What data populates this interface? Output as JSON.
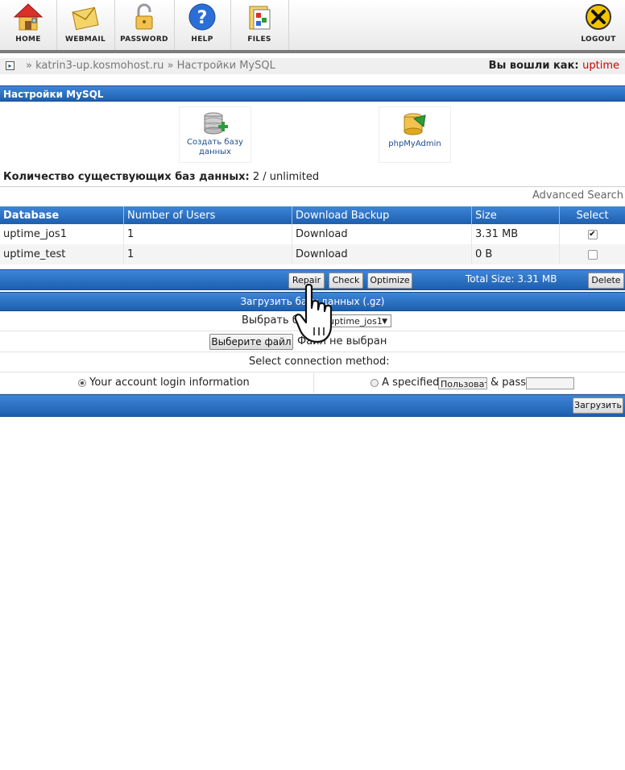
{
  "toolbar": {
    "items": [
      {
        "label": "HOME",
        "icon": "home-icon"
      },
      {
        "label": "WEBMAIL",
        "icon": "webmail-icon"
      },
      {
        "label": "PASSWORD",
        "icon": "lock-icon"
      },
      {
        "label": "HELP",
        "icon": "help-icon"
      },
      {
        "label": "FILES",
        "icon": "files-icon"
      }
    ],
    "logout": "LOGOUT"
  },
  "breadcrumb": {
    "host": "» katrin3-up.kosmohost.ru",
    "page": "» Настройки MySQL"
  },
  "login": {
    "label": "Вы вошли как:",
    "user": "uptime"
  },
  "section_title": "Настройки MySQL",
  "shortcuts": {
    "create_db": "Создать базу данных",
    "phpmyadmin": "phpMyAdmin"
  },
  "count": {
    "label": "Количество существующих баз данных:",
    "value": "2 / unlimited"
  },
  "advanced_search": "Advanced Search",
  "table": {
    "headers": [
      "Database",
      "Number of Users",
      "Download Backup",
      "Size",
      "Select"
    ],
    "rows": [
      {
        "database": "uptime_jos1",
        "users": "1",
        "download": "Download",
        "size": "3.31 MB",
        "selected": true
      },
      {
        "database": "uptime_test",
        "users": "1",
        "download": "Download",
        "size": "0 B",
        "selected": false
      }
    ]
  },
  "actions": {
    "repair": "Repair",
    "check": "Check",
    "optimize": "Optimize",
    "total": "Total Size: 3.31 MB",
    "delete": "Delete"
  },
  "upload": {
    "title": "Загрузить базу данных (.gz)",
    "select_label": "Выбрать базу",
    "select_value": "uptime_jos1",
    "file_button": "Выберите файл",
    "file_status": "Файл не выбран",
    "method_label": "Select connection method:",
    "option_account": "Your account login information",
    "option_specified": "A specified",
    "user_placeholder": "Пользователь",
    "pass_label": "& pass",
    "submit": "Загрузить"
  },
  "colors": {
    "accent_blue": "#2a6fc1",
    "user_red": "#d60000"
  }
}
